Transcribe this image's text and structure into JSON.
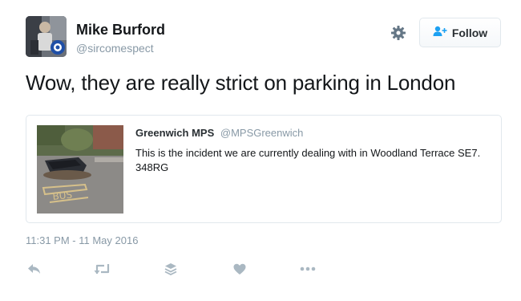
{
  "tweet": {
    "author_name": "Mike Burford",
    "author_handle": "@sircomespect",
    "text": "Wow, they are really strict on parking in London",
    "timestamp": "11:31 PM - 11 May 2016"
  },
  "follow_button": {
    "label": "Follow"
  },
  "quoted_tweet": {
    "author_name": "Greenwich MPS",
    "author_handle": "@MPSGreenwich",
    "text": "This is the incident we are currently dealing with in Woodland Terrace SE7. 348RG"
  },
  "icons": {
    "settings": "gear-icon",
    "follow": "add-user-icon",
    "reply": "reply-icon",
    "retweet": "retweet-icon",
    "buffer": "buffer-stack-icon",
    "like": "heart-icon",
    "more": "more-dots-icon"
  },
  "colors": {
    "text": "#14171a",
    "muted": "#8899a6",
    "action_icon": "#aab8c2",
    "follow_icon": "#1da1f2",
    "border": "#e1e8ed"
  }
}
